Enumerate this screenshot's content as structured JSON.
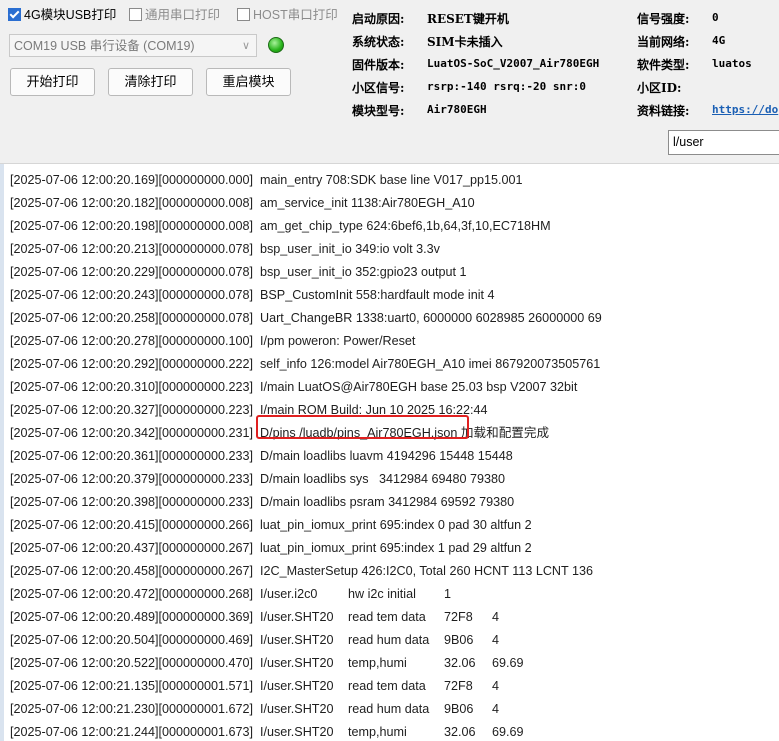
{
  "toolbar": {
    "checkboxes": [
      {
        "label": "4G模块USB打印",
        "checked": true,
        "enabled": true
      },
      {
        "label": "通用串口打印",
        "checked": false,
        "enabled": false
      },
      {
        "label": "HOST串口打印",
        "checked": false,
        "enabled": false
      }
    ],
    "port_select": "COM19 USB 串行设备 (COM19)",
    "status_color": "#27b31a",
    "buttons": {
      "start": "开始打印",
      "clear": "清除打印",
      "restart": "重启模块"
    }
  },
  "info": {
    "boot_reason_label": "启动原因:",
    "boot_reason": "RESET键开机",
    "sys_state_label": "系统状态:",
    "sys_state": "SIM卡未插入",
    "firmware_label": "固件版本:",
    "firmware": "LuatOS-SoC_V2007_Air780EGH",
    "cell_signal_label": "小区信号:",
    "cell_signal": "rsrp:-140 rsrq:-20 snr:0",
    "module_type_label": "模块型号:",
    "module_type": "Air780EGH",
    "signal_strength_label": "信号强度:",
    "signal_strength": "0",
    "network_label": "当前网络:",
    "network": "4G",
    "software_label": "软件类型:",
    "software": "luatos",
    "cell_id_label": "小区ID:",
    "cell_id": "",
    "docs_label": "资料链接:",
    "docs_link": "https://do"
  },
  "filter": {
    "value": "l/user"
  },
  "log": [
    {
      "ts": "[2025-07-06 12:00:20.169][000000000.000]",
      "msg": "main_entry 708:SDK base line V017_pp15.001"
    },
    {
      "ts": "[2025-07-06 12:00:20.182][000000000.008]",
      "msg": "am_service_init 1138:Air780EGH_A10"
    },
    {
      "ts": "[2025-07-06 12:00:20.198][000000000.008]",
      "msg": "am_get_chip_type 624:6bef6,1b,64,3f,10,EC718HM"
    },
    {
      "ts": "[2025-07-06 12:00:20.213][000000000.078]",
      "msg": "bsp_user_init_io 349:io volt 3.3v"
    },
    {
      "ts": "[2025-07-06 12:00:20.229][000000000.078]",
      "msg": "bsp_user_init_io 352:gpio23 output 1"
    },
    {
      "ts": "[2025-07-06 12:00:20.243][000000000.078]",
      "msg": "BSP_CustomInit 558:hardfault mode init 4"
    },
    {
      "ts": "[2025-07-06 12:00:20.258][000000000.078]",
      "msg": "Uart_ChangeBR 1338:uart0, 6000000 6028985 26000000 69"
    },
    {
      "ts": "[2025-07-06 12:00:20.278][000000000.100]",
      "msg": "I/pm poweron: Power/Reset"
    },
    {
      "ts": "[2025-07-06 12:00:20.292][000000000.222]",
      "msg": "self_info 126:model Air780EGH_A10 imei 867920073505761"
    },
    {
      "ts": "[2025-07-06 12:00:20.310][000000000.223]",
      "msg": "I/main LuatOS@Air780EGH base 25.03 bsp V2007 32bit"
    },
    {
      "ts": "[2025-07-06 12:00:20.327][000000000.223]",
      "msg": "I/main ROM Build: Jun 10 2025 16:22:44"
    },
    {
      "ts": "[2025-07-06 12:00:20.342][000000000.231]",
      "msg": "D/pins /luadb/pins_Air780EGH.json 加载和配置完成"
    },
    {
      "ts": "[2025-07-06 12:00:20.361][000000000.233]",
      "msg": "D/main loadlibs luavm 4194296 15448 15448"
    },
    {
      "ts": "[2025-07-06 12:00:20.379][000000000.233]",
      "msg": "D/main loadlibs sys   3412984 69480 79380"
    },
    {
      "ts": "[2025-07-06 12:00:20.398][000000000.233]",
      "msg": "D/main loadlibs psram 3412984 69592 79380"
    },
    {
      "ts": "[2025-07-06 12:00:20.415][000000000.266]",
      "msg": "luat_pin_iomux_print 695:index 0 pad 30 altfun 2"
    },
    {
      "ts": "[2025-07-06 12:00:20.437][000000000.267]",
      "msg": "luat_pin_iomux_print 695:index 1 pad 29 altfun 2"
    },
    {
      "ts": "[2025-07-06 12:00:20.458][000000000.267]",
      "msg": "I2C_MasterSetup 426:I2C0, Total 260 HCNT 113 LCNT 136"
    },
    {
      "ts": "[2025-07-06 12:00:20.472][000000000.268]",
      "msg": "I/user.i2c0\thw i2c initial\t1"
    },
    {
      "ts": "[2025-07-06 12:00:20.489][000000000.369]",
      "msg": "I/user.SHT20\tread tem data\t72F8\t4"
    },
    {
      "ts": "[2025-07-06 12:00:20.504][000000000.469]",
      "msg": "I/user.SHT20\tread hum data\t9B06\t4"
    },
    {
      "ts": "[2025-07-06 12:00:20.522][000000000.470]",
      "msg": "I/user.SHT20\ttemp,humi\t32.06\t69.69"
    },
    {
      "ts": "[2025-07-06 12:00:21.135][000000001.571]",
      "msg": "I/user.SHT20\tread tem data\t72F8\t4"
    },
    {
      "ts": "[2025-07-06 12:00:21.230][000000001.672]",
      "msg": "I/user.SHT20\tread hum data\t9B06\t4"
    },
    {
      "ts": "[2025-07-06 12:00:21.244][000000001.673]",
      "msg": "I/user.SHT20\ttemp,humi\t32.06\t69.69"
    }
  ]
}
